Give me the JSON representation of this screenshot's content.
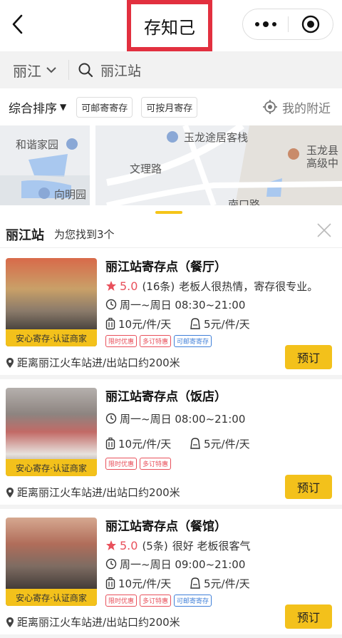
{
  "nav": {
    "title": "存知己"
  },
  "search": {
    "city": "丽江",
    "query": "丽江站"
  },
  "filters": {
    "sort": "综合排序",
    "sort_arrow": "▼",
    "chip1": "可邮寄寄存",
    "chip2": "可按月寄存",
    "nearby": "我的附近"
  },
  "map": {
    "labels": [
      "和谐家园",
      "玉龙途居客栈",
      "文理路",
      "玉龙县",
      "高级中",
      "向明园",
      "南口路"
    ]
  },
  "sheet": {
    "station": "丽江站",
    "found": "为您找到3个"
  },
  "cards": [
    {
      "name": "丽江站寄存点（餐厅）",
      "score": "5.0",
      "count": "(16条)",
      "review": "老板人很热情，寄存很专业。",
      "hours": "周一~周日 08:30~21:00",
      "price_luggage": "10元/件/天",
      "price_bag": "5元/件/天",
      "tags": [
        "限时优惠",
        "多订特惠",
        "可邮寄寄存"
      ],
      "badge": "安心寄存·认证商家",
      "distance": "距离丽江火车站进/出站口约200米",
      "book": "预订"
    },
    {
      "name": "丽江站寄存点（饭店）",
      "hours": "周一~周日 08:00~21:00",
      "price_luggage": "10元/件/天",
      "price_bag": "5元/件/天",
      "tags": [
        "限时优惠",
        "多订特惠"
      ],
      "badge": "安心寄存·认证商家",
      "distance": "距离丽江火车站进/出站口约200米",
      "book": "预订"
    },
    {
      "name": "丽江站寄存点（餐馆）",
      "score": "5.0",
      "count": "(5条)",
      "review": "很好 老板很客气",
      "hours": "周一~周日 09:00~21:00",
      "price_luggage": "10元/件/天",
      "price_bag": "5元/件/天",
      "tags": [
        "限时优惠",
        "多订特惠",
        "可邮寄寄存"
      ],
      "badge": "安心寄存·认证商家",
      "distance": "距离丽江火车站进/出站口约200米",
      "book": "预订"
    }
  ],
  "colors": {
    "accent": "#f3c11b",
    "rating": "#e8505b",
    "highlight_box": "#e2303f"
  }
}
